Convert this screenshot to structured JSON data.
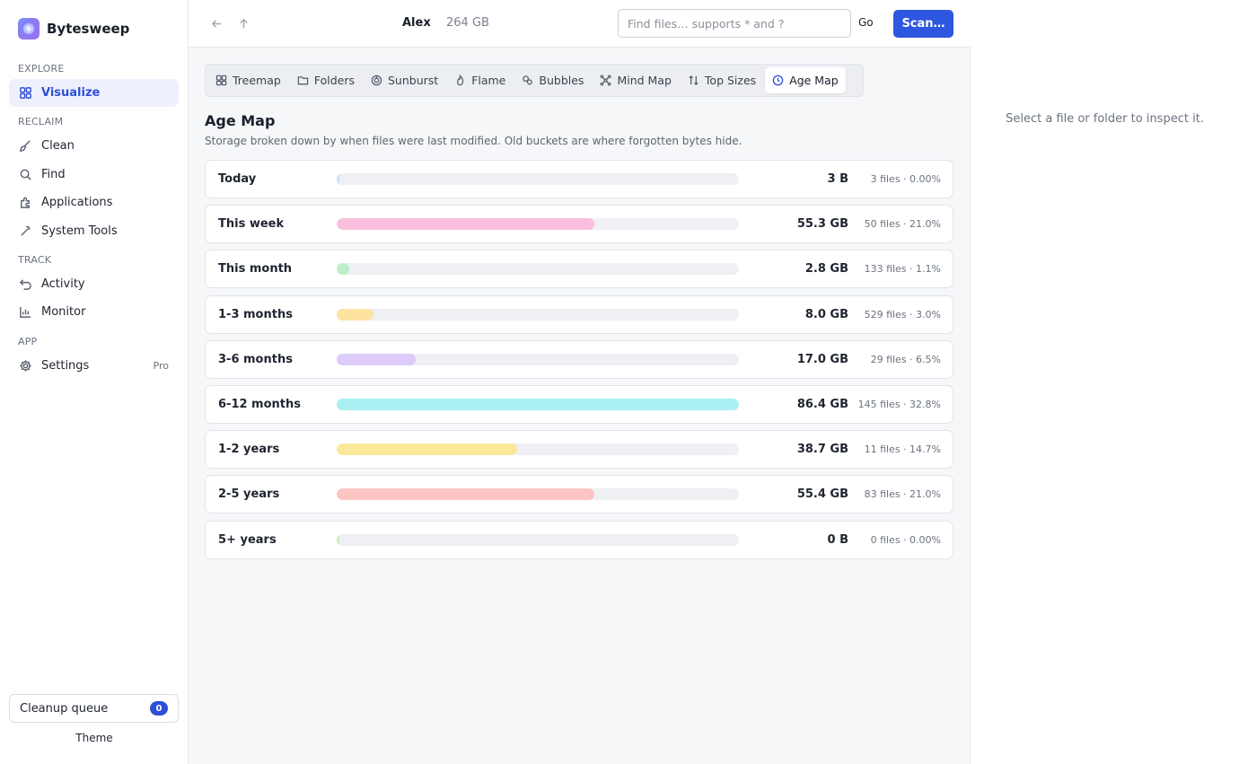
{
  "app": {
    "name": "Bytesweep"
  },
  "sidebar": {
    "sections": {
      "explore": "EXPLORE",
      "reclaim": "RECLAIM",
      "track": "TRACK",
      "app": "APP"
    },
    "items": [
      {
        "label": "Visualize",
        "icon": "grid-icon",
        "active": true
      },
      {
        "label": "Clean",
        "icon": "broom-icon"
      },
      {
        "label": "Find",
        "icon": "search-icon"
      },
      {
        "label": "Applications",
        "icon": "puzzle-icon"
      },
      {
        "label": "System Tools",
        "icon": "wand-icon"
      },
      {
        "label": "Activity",
        "icon": "undo-icon"
      },
      {
        "label": "Monitor",
        "icon": "bar-chart-icon"
      },
      {
        "label": "Settings",
        "icon": "gear-icon",
        "badge": "Pro"
      }
    ],
    "queue": {
      "label": "Cleanup queue",
      "count": "0"
    },
    "theme_label": "Theme"
  },
  "topbar": {
    "user": "Alex",
    "total_size": "264 GB",
    "search_placeholder": "Find files… supports * and ?",
    "go_label": "Go",
    "scan_label": "Scan…"
  },
  "tabs": [
    {
      "label": "Treemap",
      "icon": "treemap-icon"
    },
    {
      "label": "Folders",
      "icon": "folder-icon"
    },
    {
      "label": "Sunburst",
      "icon": "sunburst-icon"
    },
    {
      "label": "Flame",
      "icon": "flame-icon"
    },
    {
      "label": "Bubbles",
      "icon": "bubbles-icon"
    },
    {
      "label": "Mind Map",
      "icon": "mindmap-icon"
    },
    {
      "label": "Top Sizes",
      "icon": "sort-icon"
    },
    {
      "label": "Age Map",
      "icon": "clock-icon",
      "active": true
    }
  ],
  "page": {
    "title": "Age Map",
    "subtitle": "Storage broken down by when files were last modified. Old buckets are where forgotten bytes hide."
  },
  "buckets": [
    {
      "label": "Today",
      "size": "3 B",
      "meta": "3 files · 0.00%",
      "fraction": 0.0,
      "color": "#cfe0fb"
    },
    {
      "label": "This week",
      "size": "55.3 GB",
      "meta": "50 files · 21.0%",
      "fraction": 0.64,
      "color": "#f9bfdc"
    },
    {
      "label": "This month",
      "size": "2.8 GB",
      "meta": "133 files · 1.1%",
      "fraction": 0.032,
      "color": "#bbf0c9"
    },
    {
      "label": "1-3 months",
      "size": "8.0 GB",
      "meta": "529 files · 3.0%",
      "fraction": 0.092,
      "color": "#fde2a0"
    },
    {
      "label": "3-6 months",
      "size": "17.0 GB",
      "meta": "29 files · 6.5%",
      "fraction": 0.197,
      "color": "#dccbfb"
    },
    {
      "label": "6-12 months",
      "size": "86.4 GB",
      "meta": "145 files · 32.8%",
      "fraction": 1.0,
      "color": "#aaf0f2"
    },
    {
      "label": "1-2 years",
      "size": "38.7 GB",
      "meta": "11 files · 14.7%",
      "fraction": 0.448,
      "color": "#fce89a"
    },
    {
      "label": "2-5 years",
      "size": "55.4 GB",
      "meta": "83 files · 21.0%",
      "fraction": 0.641,
      "color": "#fdc4c4"
    },
    {
      "label": "5+ years",
      "size": "0 B",
      "meta": "0 files · 0.00%",
      "fraction": 0.0,
      "color": "#c8f0c0"
    }
  ],
  "inspector": {
    "message": "Select a file or folder to inspect it."
  }
}
